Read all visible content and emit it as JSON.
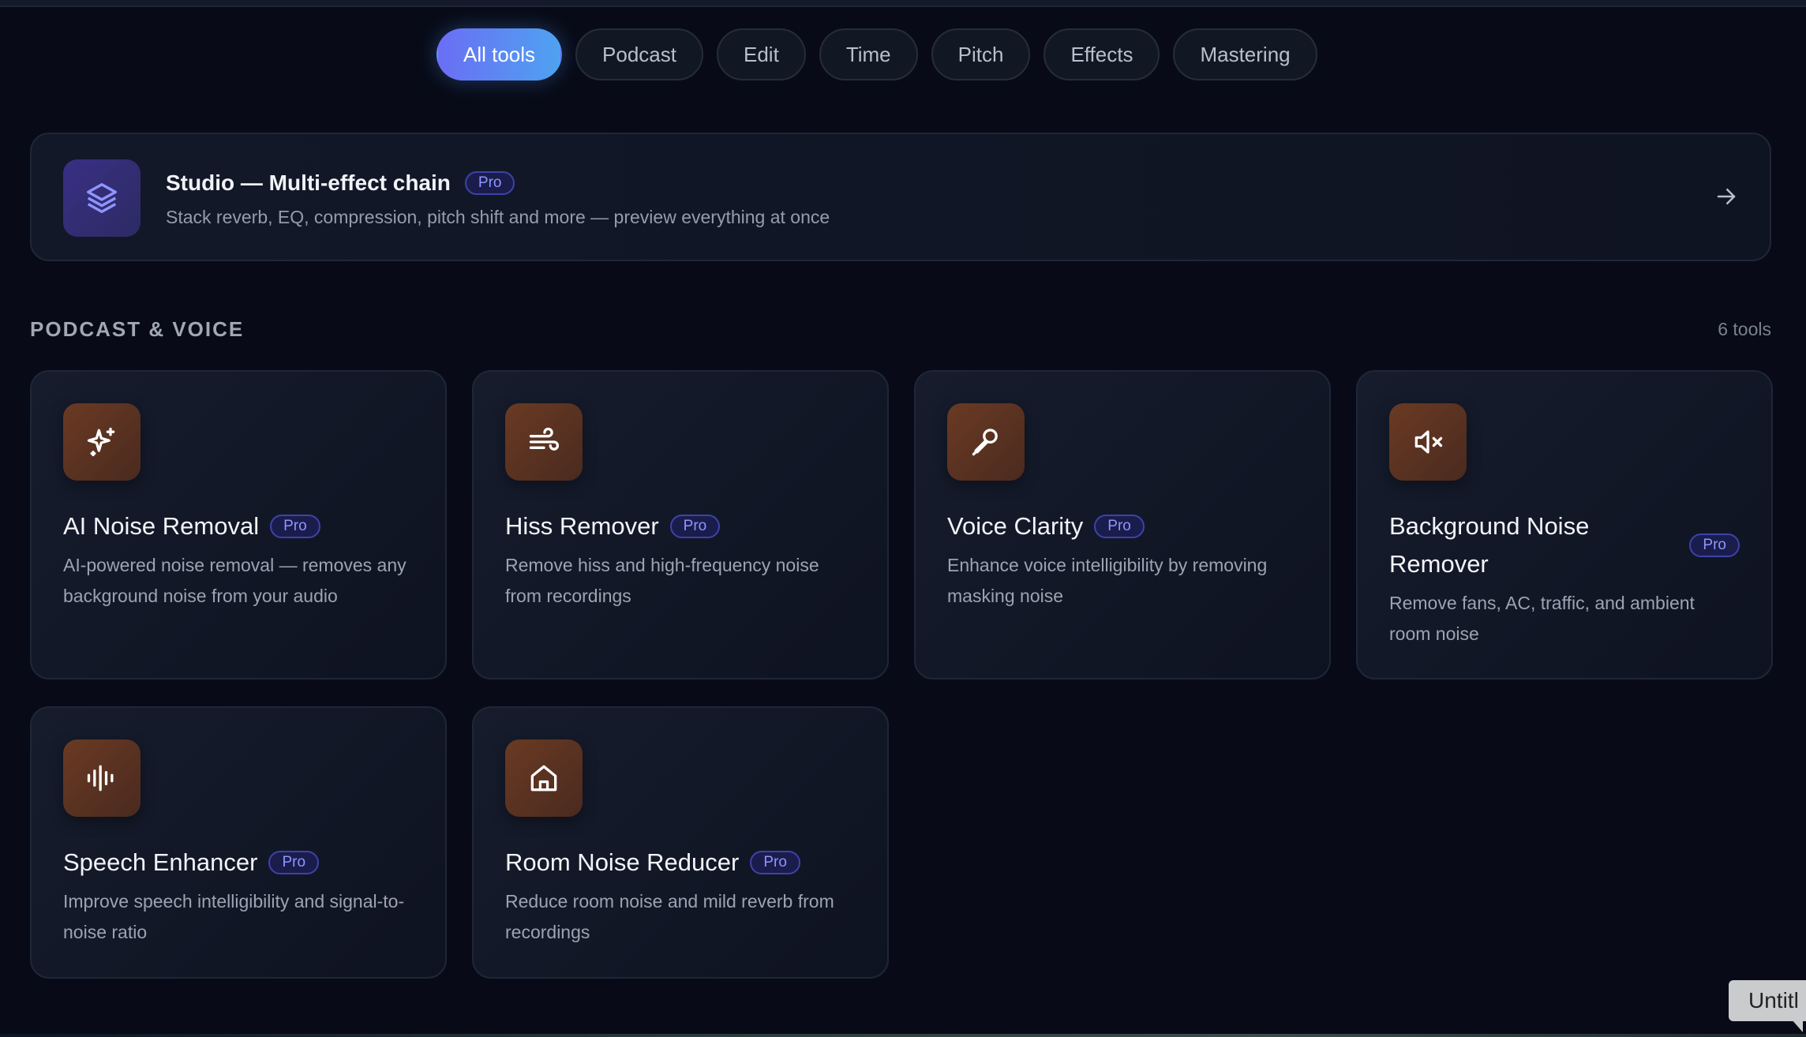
{
  "filters": [
    "All tools",
    "Podcast",
    "Edit",
    "Time",
    "Pitch",
    "Effects",
    "Mastering"
  ],
  "active_filter": "All tools",
  "studio": {
    "icon": "layers-icon",
    "title": "Studio — Multi-effect chain",
    "badge": "Pro",
    "description": "Stack reverb, EQ, compression, pitch shift and more — preview everything at once",
    "arrow_icon": "arrow-right-icon"
  },
  "section": {
    "title": "PODCAST & VOICE",
    "count": "6 tools"
  },
  "tools": [
    {
      "icon": "sparkles-icon",
      "name": "AI Noise Removal",
      "badge": "Pro",
      "description": "AI-powered noise removal — removes any background noise from your audio"
    },
    {
      "icon": "wind-icon",
      "name": "Hiss Remover",
      "badge": "Pro",
      "description": "Remove hiss and high-frequency noise from recordings"
    },
    {
      "icon": "microphone-icon",
      "name": "Voice Clarity",
      "badge": "Pro",
      "description": "Enhance voice intelligibility by removing masking noise"
    },
    {
      "icon": "speaker-mute-icon",
      "name": "Background Noise Remover",
      "badge": "Pro",
      "description": "Remove fans, AC, traffic, and ambient room noise"
    },
    {
      "icon": "waveform-icon",
      "name": "Speech Enhancer",
      "badge": "Pro",
      "description": "Improve speech intelligibility and signal-to-noise ratio"
    },
    {
      "icon": "home-icon",
      "name": "Room Noise Reducer",
      "badge": "Pro",
      "description": "Reduce room noise and mild reverb from recordings"
    }
  ],
  "tooltip": "Untitl",
  "colors": {
    "background": "#080b17",
    "accent_start": "#6a6ef4",
    "accent_end": "#4fa2f1",
    "pro_badge": "#8e95ff",
    "tool_icon_bg": "#5a3322"
  }
}
